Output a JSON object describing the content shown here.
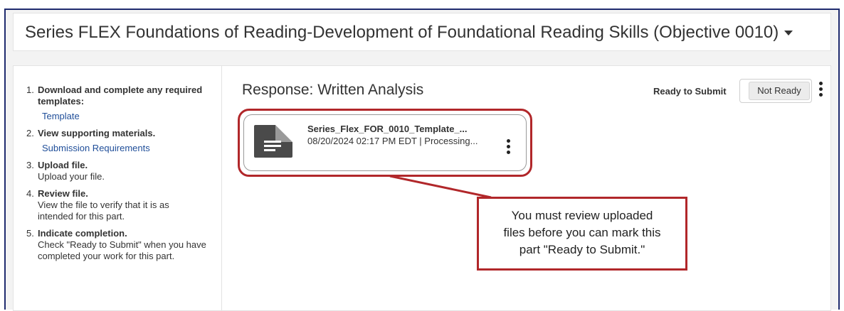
{
  "header": {
    "title": "Series FLEX Foundations of Reading-Development of Foundational Reading Skills (Objective 0010)"
  },
  "sidebar": {
    "steps": [
      {
        "num": "1.",
        "title": "Download and complete any required templates:",
        "link": "Template"
      },
      {
        "num": "2.",
        "title": "View supporting materials.",
        "link": "Submission Requirements"
      },
      {
        "num": "3.",
        "title": "Upload file.",
        "desc": "Upload your file."
      },
      {
        "num": "4.",
        "title": "Review file.",
        "desc": "View the file to verify that it is as intended for this part."
      },
      {
        "num": "5.",
        "title": "Indicate completion.",
        "desc": "Check \"Ready to Submit\" when you have completed your work for this part."
      }
    ]
  },
  "main": {
    "section_title": "Response: Written Analysis",
    "ready_label": "Ready to Submit",
    "ready_state": "Not Ready",
    "file": {
      "name": "Series_Flex_FOR_0010_Template_...",
      "meta": "08/20/2024 02:17 PM EDT | Processing..."
    }
  },
  "callout": {
    "text": "You must review uploaded files before you can mark this part \"Ready to Submit.\""
  },
  "colors": {
    "highlight": "#b1272a",
    "link": "#1f4e99",
    "frame": "#1f2b6e"
  },
  "icons": [
    "chevron-down-icon",
    "document-icon",
    "kebab-menu-icon"
  ]
}
